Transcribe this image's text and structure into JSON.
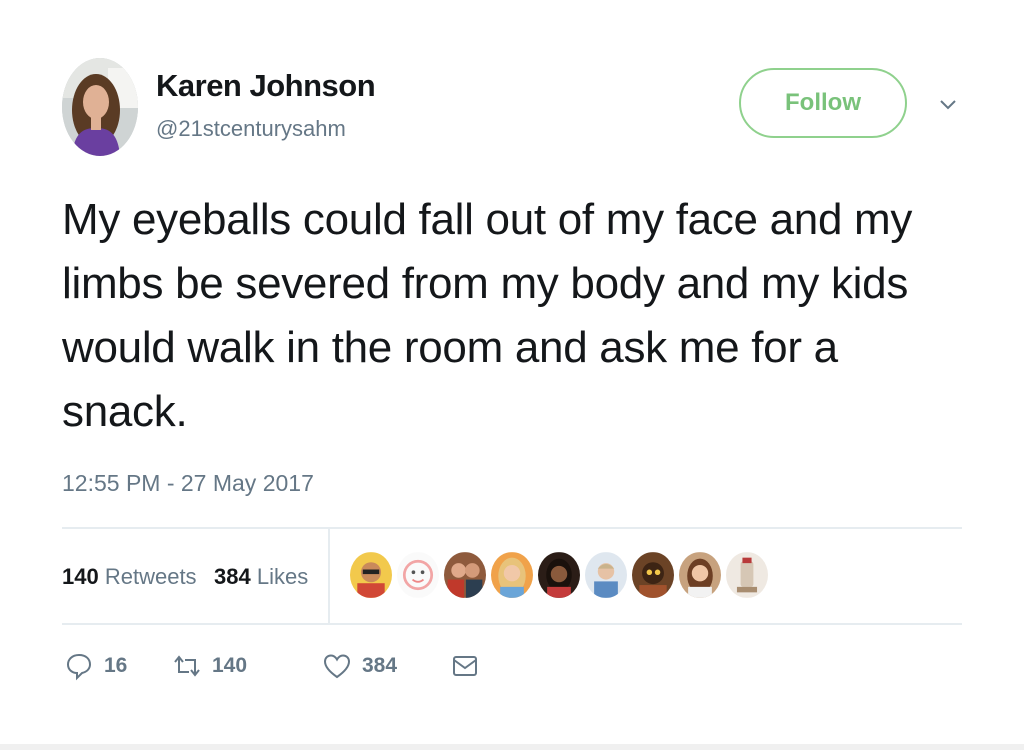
{
  "tweet": {
    "author_name": "Karen Johnson",
    "author_handle": "@21stcenturysahm",
    "follow_label": "Follow",
    "text": "My eyeballs could fall out of my face and my limbs be severed from my body and my kids would walk in the room and ask me for a snack.",
    "timestamp": "12:55 PM - 27 May 2017"
  },
  "stats": {
    "retweets_count": "140",
    "retweets_label": "Retweets",
    "likes_count": "384",
    "likes_label": "Likes"
  },
  "actions": {
    "reply_count": "16",
    "retweet_count": "140",
    "like_count": "384"
  },
  "icons": {
    "caret": "chevron-down-icon",
    "reply": "reply-icon",
    "retweet": "retweet-icon",
    "like": "heart-icon",
    "dm": "direct-message-icon"
  },
  "colors": {
    "follow_border": "#8fd18d",
    "follow_text": "#79c27a",
    "secondary_text": "#657786",
    "primary_text": "#14171a"
  }
}
